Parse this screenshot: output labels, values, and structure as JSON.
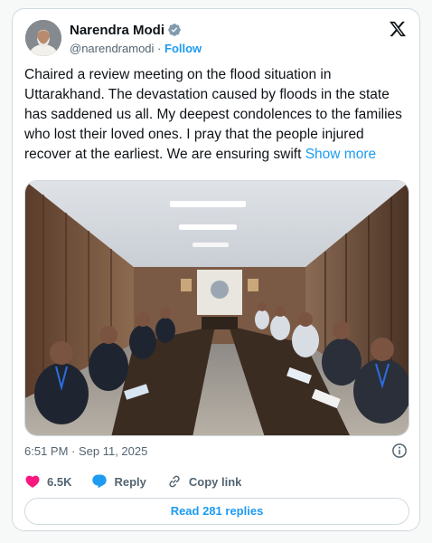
{
  "author": {
    "display_name": "Narendra Modi",
    "handle": "@narendramodi",
    "separator": "·",
    "follow_label": "Follow"
  },
  "tweet": {
    "text": "Chaired a review meeting on the flood situation in Uttarakhand. The devastation caused by floods in the state has saddened us all. My deepest condolences to the families who lost their loved ones. I pray that the people injured recover at the earliest. We are ensuring swift",
    "show_more_label": "Show more",
    "timestamp": "6:51 PM · Sep 11, 2025"
  },
  "actions": {
    "likes_count": "6.5K",
    "reply_label": "Reply",
    "copy_link_label": "Copy link"
  },
  "read_replies_label": "Read 281 replies",
  "colors": {
    "accent": "#1d9bf0",
    "like": "#f91880",
    "text_secondary": "#536471"
  },
  "icons": [
    "verified-icon",
    "x-logo-icon",
    "info-icon",
    "heart-icon",
    "reply-icon",
    "link-icon"
  ]
}
